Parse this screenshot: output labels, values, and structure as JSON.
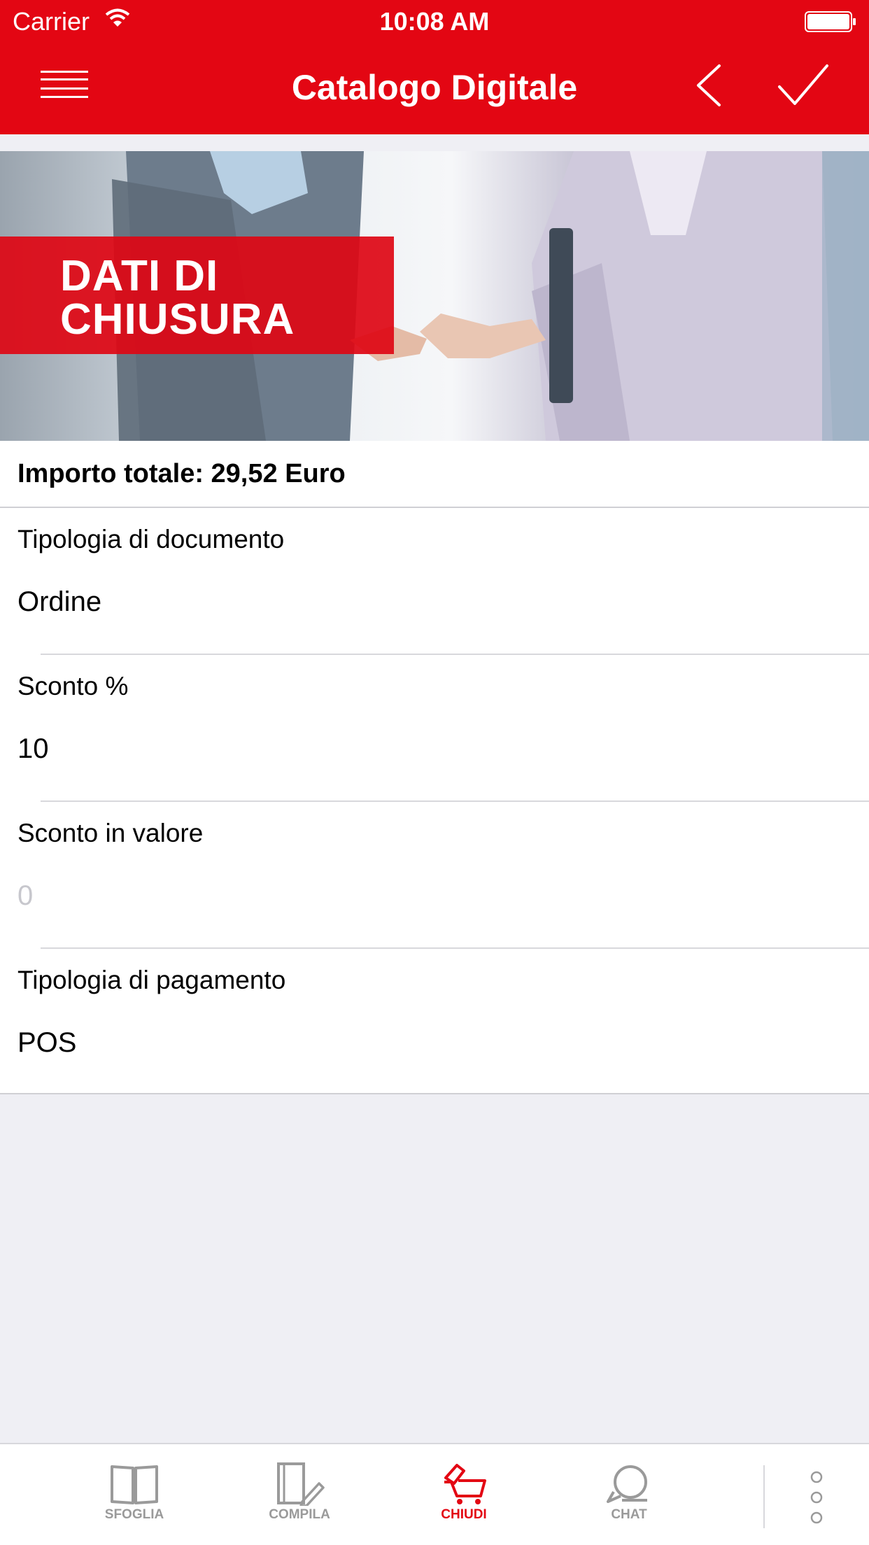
{
  "status_bar": {
    "carrier": "Carrier",
    "time": "10:08 AM"
  },
  "nav": {
    "title": "Catalogo Digitale"
  },
  "hero": {
    "line1": "DATI DI",
    "line2": "CHIUSURA"
  },
  "total": {
    "label": "Importo totale: 29,52 Euro"
  },
  "fields": [
    {
      "label": "Tipologia di documento",
      "value": "Ordine"
    },
    {
      "label": "Sconto %",
      "value": "10"
    },
    {
      "label": "Sconto in valore",
      "placeholder": "0"
    },
    {
      "label": "Tipologia di pagamento",
      "value": "POS"
    }
  ],
  "tabs": [
    {
      "label": "SFOGLIA",
      "icon": "book-icon"
    },
    {
      "label": "COMPILA",
      "icon": "edit-document-icon"
    },
    {
      "label": "CHIUDI",
      "icon": "cart-icon",
      "active": true
    },
    {
      "label": "CHAT",
      "icon": "chat-icon"
    }
  ],
  "colors": {
    "brand": "#e30613",
    "tab_inactive": "#9a9a9a",
    "background": "#efeff4"
  }
}
